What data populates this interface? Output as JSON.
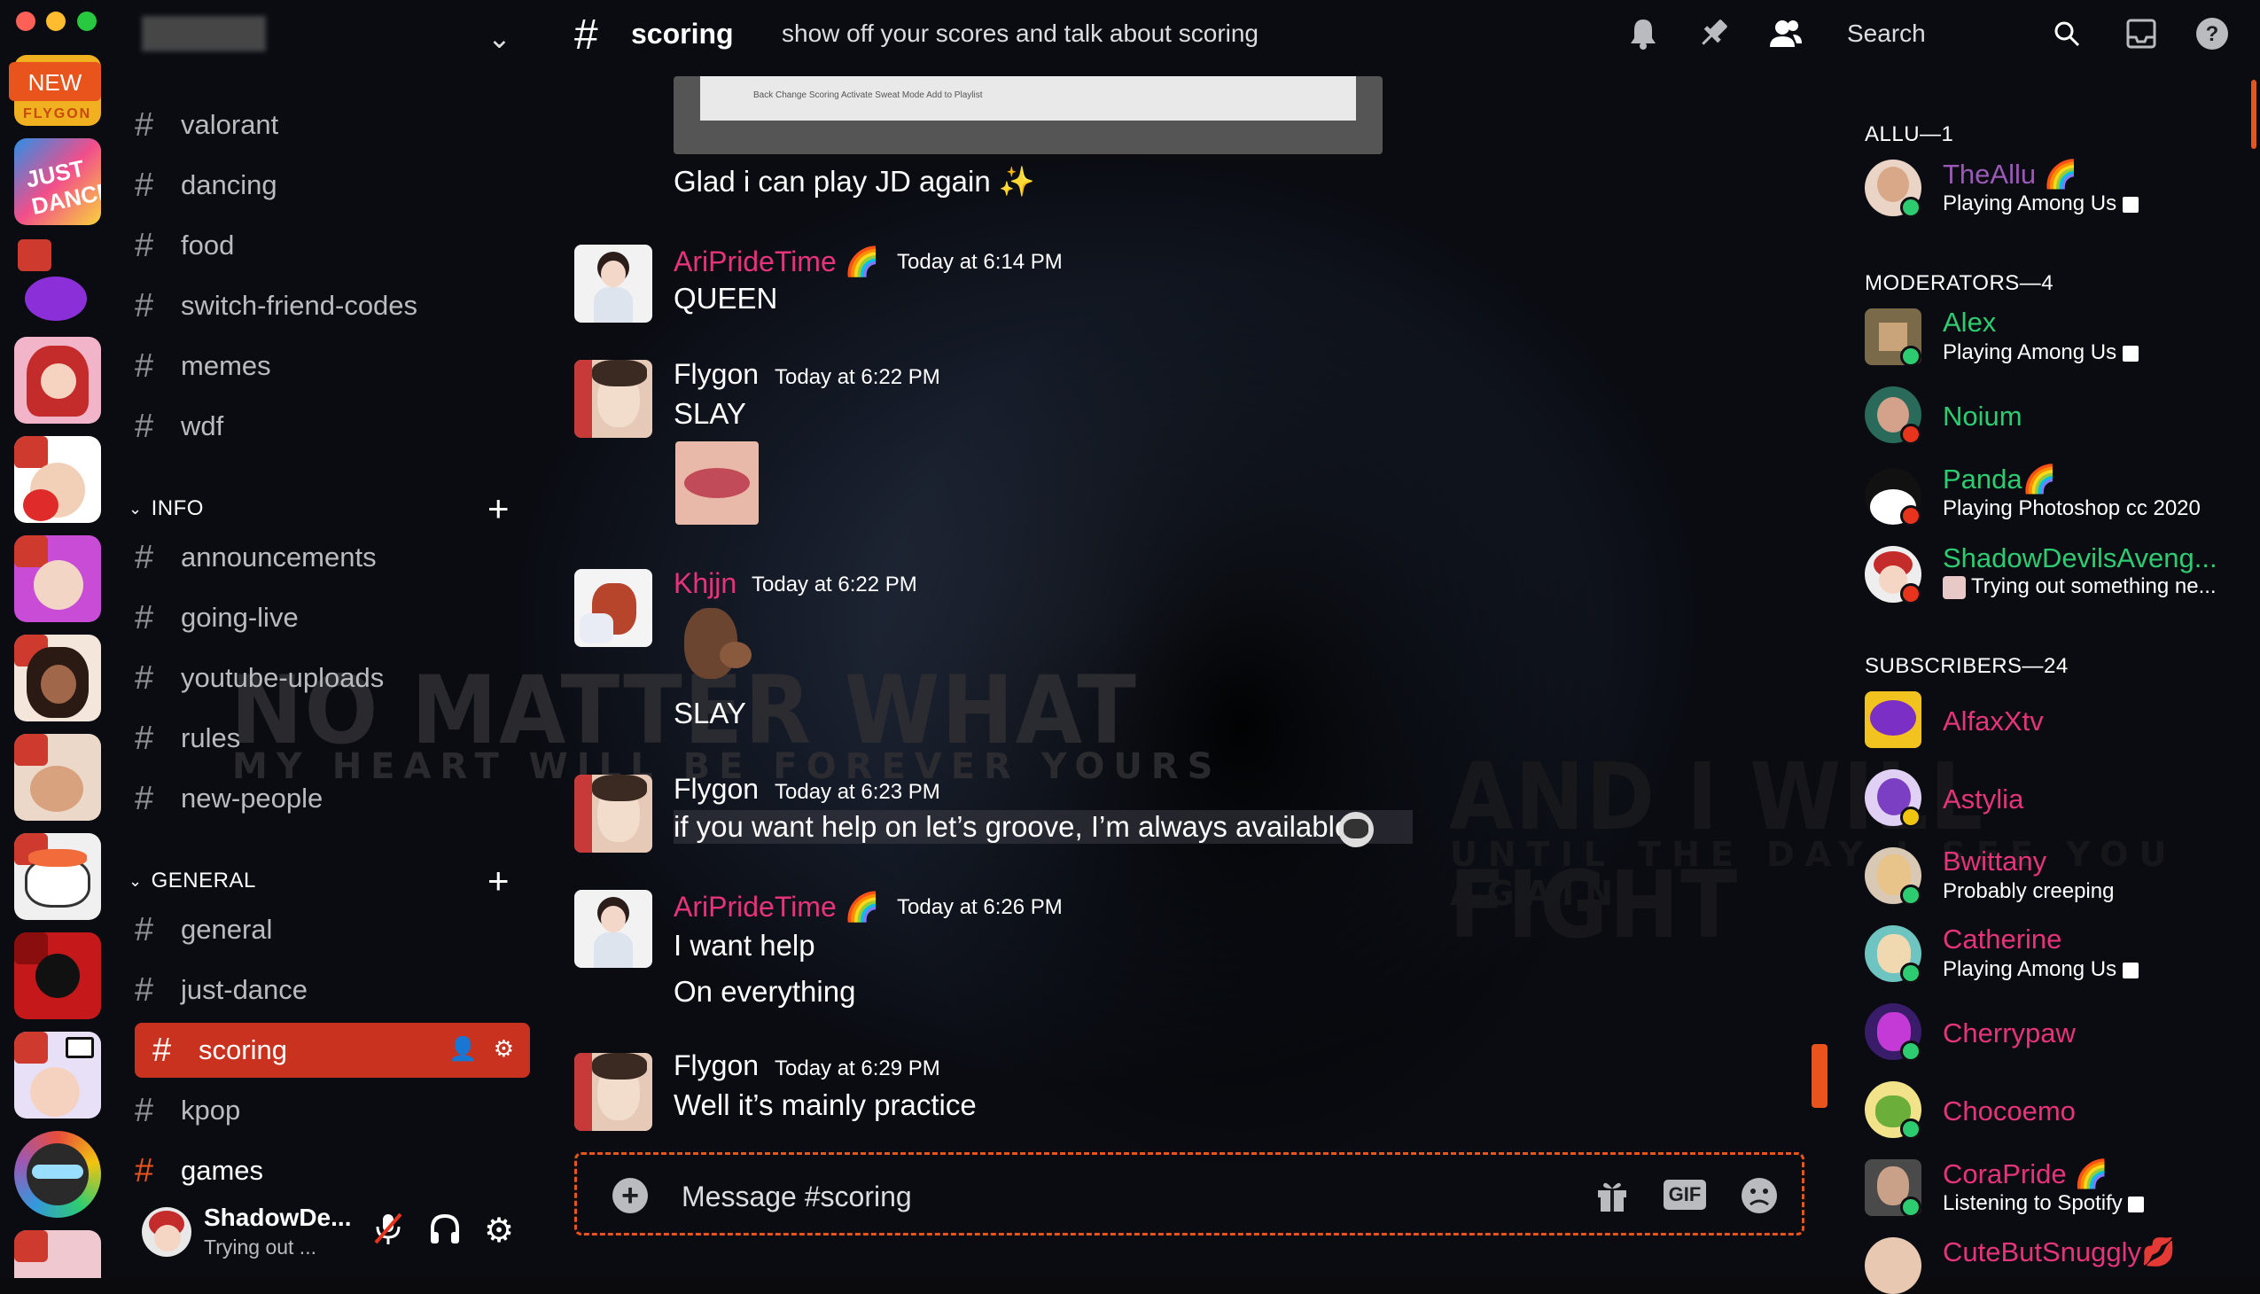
{
  "window": {
    "controls": [
      "close",
      "minimize",
      "maximize"
    ]
  },
  "rail": {
    "new_badge": "NEW",
    "top_server_label": "FLYGON",
    "servers": [
      "just-dance",
      "purple-blob",
      "red-hair-girl",
      "anime-boy",
      "purple-girl",
      "dark-girl",
      "cat-girl",
      "sushi",
      "deadpool",
      "screen-share-user",
      "rainbow-sunglasses",
      "bottom-server"
    ]
  },
  "sidebar": {
    "channels_top": [
      "valorant",
      "dancing",
      "food",
      "switch-friend-codes",
      "memes",
      "wdf"
    ],
    "info_category": "INFO",
    "info_channels": [
      "announcements",
      "going-live",
      "youtube-uploads",
      "rules",
      "new-people"
    ],
    "general_category": "GENERAL",
    "general_channels": [
      "general",
      "just-dance"
    ],
    "active_channel": "scoring",
    "after_active": [
      "kpop",
      "games"
    ]
  },
  "user_panel": {
    "name": "ShadowDe...",
    "status": "Trying out ..."
  },
  "topbar": {
    "hash": "#",
    "channel": "scoring",
    "topic": "show off your scores and talk about scoring",
    "search": "Search"
  },
  "messages": {
    "embed_caption": "Glad i can play JD again ✨",
    "embed_buttons": "Back   Change Scoring   Activate Sweat Mode   Add to Playlist",
    "items": [
      {
        "author": "AriPrideTime 🌈",
        "time": "Today at 6:14 PM",
        "lines": [
          "QUEEN"
        ]
      },
      {
        "author": "Flygon",
        "time": "Today at 6:22 PM",
        "lines": [
          "SLAY"
        ]
      },
      {
        "author": "Khjjn",
        "time": "Today at 6:22 PM",
        "lines": [
          "SLAY"
        ]
      },
      {
        "author": "Flygon",
        "time": "Today at 6:23 PM",
        "lines": [
          "if you want help on let’s groove, I’m always available"
        ]
      },
      {
        "author": "AriPrideTime 🌈",
        "time": "Today at 6:26 PM",
        "lines": [
          "I want help",
          "On everything"
        ]
      },
      {
        "author": "Flygon",
        "time": "Today at 6:29 PM",
        "lines": [
          "Well it’s mainly practice"
        ]
      }
    ]
  },
  "input": {
    "placeholder": "Message #scoring",
    "gif": "GIF"
  },
  "members": {
    "groups": [
      {
        "title": "ALLU—1"
      },
      {
        "title": "MODERATORS—4"
      },
      {
        "title": "SUBSCRIBERS—24"
      }
    ],
    "list": [
      {
        "name": "TheAllu 🌈",
        "status": "Playing Among Us",
        "color": "#9b59b6"
      },
      {
        "name": "Alex",
        "status": "Playing Among Us",
        "color": "#2ecc71"
      },
      {
        "name": "Noium",
        "status": "",
        "color": "#2ecc71"
      },
      {
        "name": "Panda🌈",
        "status": "Playing Photoshop cc 2020",
        "color": "#2ecc71"
      },
      {
        "name": "ShadowDevilsAveng...",
        "status": "Trying out something ne...",
        "color": "#2ecc71"
      },
      {
        "name": "AlfaxXtv",
        "status": "",
        "color": "#e6347a"
      },
      {
        "name": "Astylia",
        "status": "",
        "color": "#e6347a"
      },
      {
        "name": "Bwittany",
        "status": "Probably creeping",
        "color": "#e6347a"
      },
      {
        "name": "Catherine",
        "status": "Playing Among Us",
        "color": "#e6347a"
      },
      {
        "name": "Cherrypaw",
        "status": "",
        "color": "#e6347a"
      },
      {
        "name": "Chocoemo",
        "status": "",
        "color": "#e6347a"
      },
      {
        "name": "CoraPride 🌈",
        "status": "Listening to Spotify",
        "color": "#e6347a"
      },
      {
        "name": "CuteButSnuggly💋",
        "status": "",
        "color": "#e6347a"
      }
    ]
  },
  "background": {
    "line1": "NO MATTER WHAT",
    "line2": "MY HEART WILL BE FOREVER YOURS",
    "line3": "AND I WILL FIGHT",
    "line4": "UNTIL THE DAY I SEE YOU AGAIN"
  },
  "colors": {
    "accent": "#e8541c",
    "active": "#c8321f",
    "pink": "#e6347a",
    "green": "#2ecc71",
    "purple": "#9b59b6"
  }
}
